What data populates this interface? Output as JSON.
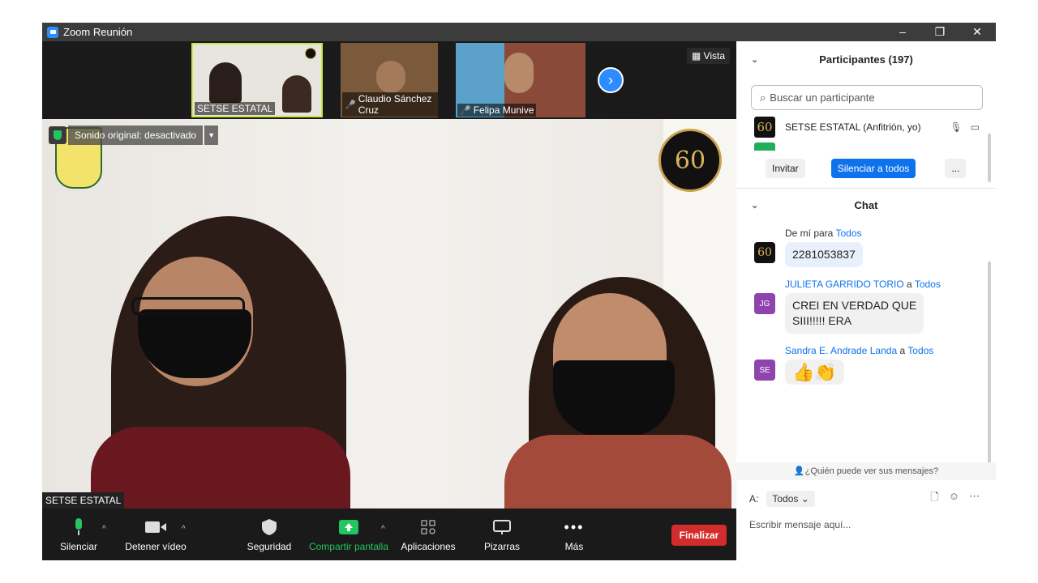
{
  "window": {
    "title": "Zoom Reunión",
    "controls": [
      "–",
      "❐",
      "✕"
    ]
  },
  "thumbnails": [
    {
      "name": "SETSE ESTATAL",
      "muted": false
    },
    {
      "name": "Claudio Sánchez Cruz",
      "muted": true
    },
    {
      "name": "Felipa Munive",
      "muted": true
    }
  ],
  "view_label": "Vista",
  "main_video": {
    "audio_banner": "Sonido original: desactivado",
    "badge": "60",
    "speaker_name": "SETSE ESTATAL"
  },
  "toolbar": {
    "mute": "Silenciar",
    "video": "Detener vídeo",
    "security": "Seguridad",
    "share": "Compartir pantalla",
    "apps": "Aplicaciones",
    "whiteboard": "Pizarras",
    "more": "Más",
    "end": "Finalizar"
  },
  "participants": {
    "title": "Participantes (197)",
    "search_placeholder": "Buscar un participante",
    "list": [
      {
        "name": "SETSE ESTATAL (Anfitrión, yo)",
        "avatar": "60"
      }
    ],
    "invite": "Invitar",
    "mute_all": "Silenciar a todos",
    "more": "..."
  },
  "chat": {
    "title": "Chat",
    "messages": [
      {
        "from": "De mí para",
        "to": "Todos",
        "avatar": "60",
        "text": "2281053837"
      },
      {
        "from": "JULIETA GARRIDO TORIO",
        "connector": "a",
        "to": "Todos",
        "avatar": "JG",
        "text_line1": "CREI EN VERDAD QUE",
        "text_line2": "SIII!!!!! ERA"
      },
      {
        "from": "Sandra E. Andrade Landa",
        "connector": "a",
        "to": "Todos",
        "avatar": "SE",
        "text": "👍👏"
      }
    ],
    "who_can_see": "¿Quién puede ver sus mensajes?",
    "to_label": "A:",
    "recipient": "Todos",
    "input_placeholder": "Escribir mensaje aquí..."
  },
  "colors": {
    "accent": "#0e72ed",
    "end": "#d32c2c",
    "share": "#23c55e",
    "avatar_purple": "#8e44ad"
  }
}
